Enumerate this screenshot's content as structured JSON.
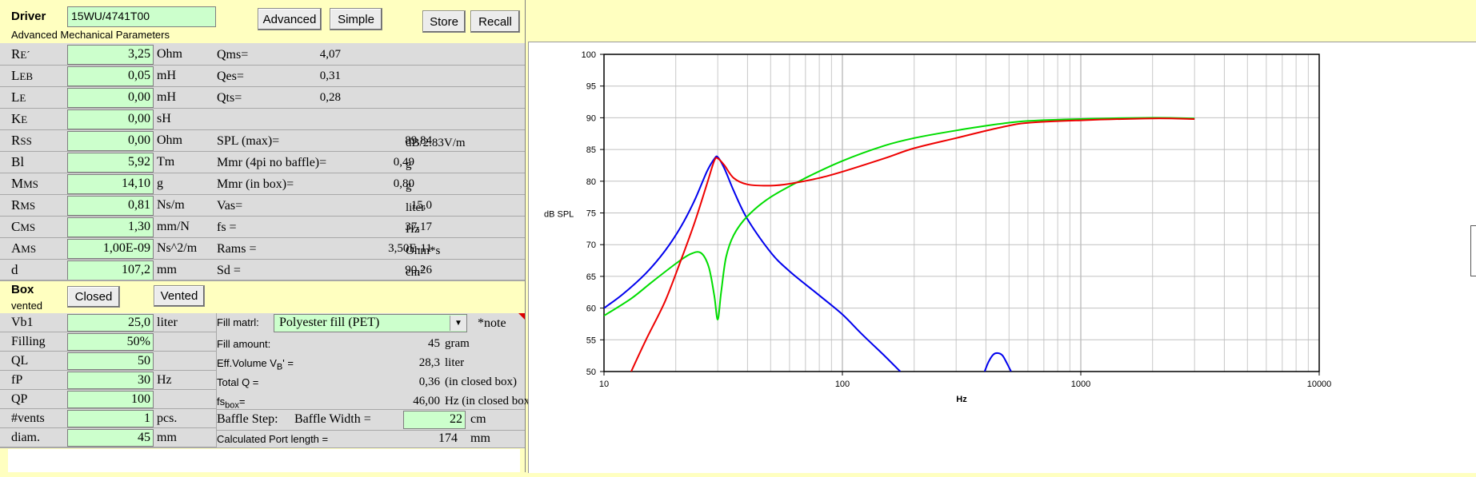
{
  "driver": {
    "label": "Driver",
    "model": "15WU/4741T00",
    "subtitle": "Advanced Mechanical Parameters"
  },
  "buttons": {
    "advanced": "Advanced",
    "simple": "Simple",
    "store": "Store",
    "recall": "Recall",
    "closed": "Closed",
    "vented": "Vented"
  },
  "params": [
    {
      "sym": "R",
      "sub": "E´",
      "value": "3,25",
      "unit": "Ohm"
    },
    {
      "sym": "L",
      "sub": "EB",
      "value": "0,05",
      "unit": "mH"
    },
    {
      "sym": "L",
      "sub": "E",
      "value": "0,00",
      "unit": "mH"
    },
    {
      "sym": "K",
      "sub": "E",
      "value": "0,00",
      "unit": "sH"
    },
    {
      "sym": "R",
      "sub": "SS",
      "value": "0,00",
      "unit": "Ohm"
    },
    {
      "sym": "Bl",
      "sub": "",
      "value": "5,92",
      "unit": "Tm"
    },
    {
      "sym": "M",
      "sub": "MS",
      "value": "14,10",
      "unit": "g"
    },
    {
      "sym": "R",
      "sub": "MS",
      "value": "0,81",
      "unit": "Ns/m"
    },
    {
      "sym": "C",
      "sub": "MS",
      "value": "1,30",
      "unit": "mm/N"
    },
    {
      "sym": "A",
      "sub": "MS",
      "value": "1,00E-09",
      "unit": "Ns^2/m"
    },
    {
      "sym": "d",
      "sub": "",
      "value": "107,2",
      "unit": "mm"
    }
  ],
  "derived": [
    {
      "label": "Qms=",
      "value": "4,07",
      "unit": ""
    },
    {
      "label": "Qes=",
      "value": "0,31",
      "unit": ""
    },
    {
      "label": "Qts=",
      "value": "0,28",
      "unit": ""
    },
    {
      "label": "",
      "value": "",
      "unit": ""
    },
    {
      "label": "SPL (max)=",
      "value": "89,84",
      "unit": "dB/2.83V/m"
    },
    {
      "label": "Mmr (4pi no baffle)=",
      "value": "0,49",
      "unit": "g"
    },
    {
      "label": "Mmr (in box)=",
      "value": "0,80",
      "unit": "g"
    },
    {
      "label": "Vas=",
      "value": "15,0",
      "unit": "liter"
    },
    {
      "label": "fs =",
      "value": "37,17",
      "unit": "Hz"
    },
    {
      "label": "Rams =",
      "value": "3,50E-11",
      "unit": "Ohm*s"
    },
    {
      "label": "Sd =",
      "value": "90,26",
      "unit": "cm",
      "unit_sup": "2"
    }
  ],
  "box": {
    "label": "Box",
    "type": "vented",
    "rows": [
      {
        "label": "Vb1",
        "value": "25,0",
        "unit": "liter"
      },
      {
        "label": "Filling",
        "value": "50%",
        "unit": ""
      },
      {
        "label": "QL",
        "value": "50",
        "unit": ""
      },
      {
        "label": "fP",
        "value": "30",
        "unit": "Hz"
      },
      {
        "label": "QP",
        "value": "100",
        "unit": ""
      },
      {
        "label": "#vents",
        "value": "1",
        "unit": "pcs."
      },
      {
        "label": "diam.",
        "value": "45",
        "unit": "mm"
      }
    ],
    "fill_label": "Fill matrl:",
    "fill_value": "Polyester fill (PET)",
    "note": "*note",
    "info": [
      {
        "label": "Fill amount:",
        "value": "45",
        "unit": "gram"
      },
      {
        "label": "Eff.Volume V",
        "label_sub": "B",
        "label_tail": "' =",
        "value": "28,3",
        "unit": "liter"
      },
      {
        "label": "Total Q =",
        "value": "0,36",
        "unit": "(in closed box)"
      },
      {
        "label": "fs",
        "label_sub": "box",
        "label_tail": "=",
        "value": "46,00",
        "unit": "Hz  (in closed box)"
      }
    ],
    "baffle_label": "Baffle Step:",
    "baffle_width_label": "Baffle Width  =",
    "baffle_width": "22",
    "baffle_unit": "cm",
    "port_label": "Calculated Port length =",
    "port_value": "174",
    "port_unit": "mm"
  },
  "chart_data": {
    "type": "line",
    "xlabel": "Hz",
    "ylabel": "dB SPL",
    "xscale": "log",
    "xlim": [
      10,
      10000
    ],
    "ylim": [
      50,
      100
    ],
    "x_ticks": [
      "10",
      "100",
      "1000",
      "10000"
    ],
    "y_ticks": [
      "50",
      "55",
      "60",
      "65",
      "70",
      "75",
      "80",
      "85",
      "90",
      "95",
      "100"
    ],
    "grid": true,
    "series": [
      {
        "color": "#0000ee",
        "x": [
          10,
          12,
          15,
          18,
          21,
          24,
          27,
          29,
          30,
          32,
          35,
          40,
          50,
          60,
          80,
          100,
          120,
          150,
          175
        ],
        "y": [
          60,
          62.2,
          65.5,
          69,
          72.8,
          77,
          81.5,
          83.5,
          83.8,
          82,
          78.5,
          74,
          68.8,
          65.8,
          62,
          59,
          56,
          52.5,
          50
        ]
      },
      {
        "color": "#0000ee",
        "x": [
          395,
          410,
          430,
          450,
          470,
          490,
          510
        ],
        "y": [
          50,
          51.5,
          52.7,
          52.9,
          52.5,
          51.3,
          50
        ]
      },
      {
        "color": "#00dd00",
        "x": [
          10,
          13,
          16,
          20,
          23,
          25.5,
          27.5,
          29,
          30,
          31,
          32.5,
          35,
          40,
          50,
          70,
          100,
          150,
          200,
          300,
          450,
          600,
          1000,
          2000,
          3000
        ],
        "y": [
          58.8,
          61.5,
          64.2,
          67,
          68.5,
          68.7,
          66.5,
          62,
          58.2,
          62.5,
          68,
          71.5,
          74.5,
          77.5,
          80.5,
          83.2,
          85.6,
          86.8,
          88,
          89,
          89.5,
          89.8,
          90,
          89.9
        ]
      },
      {
        "color": "#ee0000",
        "x": [
          13,
          15,
          18,
          21,
          24,
          27,
          29,
          30,
          32,
          35,
          40,
          50,
          60,
          80,
          100,
          150,
          200,
          300,
          450,
          600,
          1000,
          2000,
          3000
        ],
        "y": [
          50,
          55,
          61,
          67.5,
          73.5,
          79.5,
          83.2,
          83.6,
          82.5,
          80.5,
          79.5,
          79.3,
          79.6,
          80.5,
          81.5,
          83.6,
          85.2,
          86.8,
          88.4,
          89.2,
          89.6,
          89.9,
          89.8
        ]
      }
    ]
  }
}
